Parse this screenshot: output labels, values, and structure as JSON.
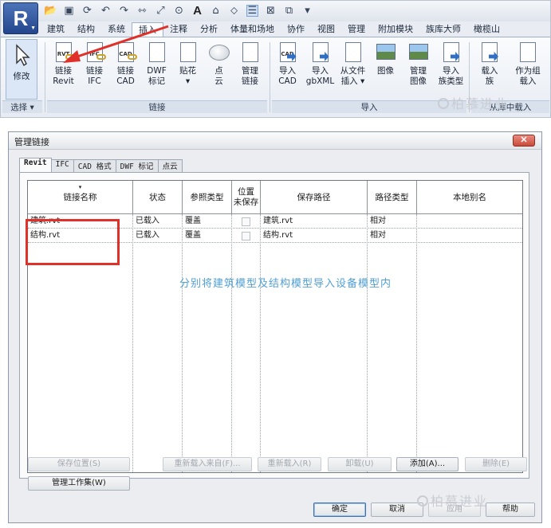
{
  "app": {
    "logo_letter": "R"
  },
  "ribbon": {
    "tabs": [
      "建筑",
      "结构",
      "系统",
      "插入",
      "注释",
      "分析",
      "体量和场地",
      "协作",
      "视图",
      "管理",
      "附加模块",
      "族库大师",
      "橄榄山"
    ],
    "active_tab": "插入",
    "modify": {
      "label": "修改",
      "panel": "选择 ▾"
    },
    "link_panel": {
      "label": "链接",
      "buttons": [
        {
          "line1": "链接",
          "line2": "Revit",
          "badge": "RVT"
        },
        {
          "line1": "链接",
          "line2": "IFC",
          "badge": "IFC"
        },
        {
          "line1": "链接",
          "line2": "CAD",
          "badge": "CAD"
        },
        {
          "line1": "DWF",
          "line2": "标记",
          "badge": ""
        },
        {
          "line1": "贴花",
          "line2": "▾",
          "badge": ""
        },
        {
          "line1": "点",
          "line2": "云",
          "badge": ""
        },
        {
          "line1": "管理",
          "line2": "链接",
          "badge": ""
        }
      ]
    },
    "import_panel": {
      "label": "导入",
      "buttons": [
        {
          "line1": "导入",
          "line2": "CAD",
          "badge": "CAD"
        },
        {
          "line1": "导入",
          "line2": "gbXML",
          "badge": ""
        },
        {
          "line1": "从文件",
          "line2": "插入 ▾",
          "badge": ""
        },
        {
          "line1": "图像",
          "line2": "",
          "badge": ""
        },
        {
          "line1": "管理",
          "line2": "图像",
          "badge": ""
        },
        {
          "line1": "导入",
          "line2": "族类型",
          "badge": ""
        }
      ]
    },
    "family_panel": {
      "label": "从库中载入",
      "buttons": [
        {
          "line1": "载入",
          "line2": "族"
        },
        {
          "line1": "作为组",
          "line2": "载入"
        }
      ]
    }
  },
  "watermark": "柏慕进业",
  "dialog": {
    "title": "管理链接",
    "tabs": [
      "Revit",
      "IFC",
      "CAD 格式",
      "DWF 标记",
      "点云"
    ],
    "active_tab": "Revit",
    "columns": [
      "链接名称",
      "状态",
      "参照类型",
      "位置\n未保存",
      "保存路径",
      "路径类型",
      "本地别名"
    ],
    "rows": [
      {
        "name": "建筑.rvt",
        "status": "已载入",
        "ref_type": "覆盖",
        "unsaved": false,
        "path": "建筑.rvt",
        "path_type": "相对",
        "alias": ""
      },
      {
        "name": "结构.rvt",
        "status": "已载入",
        "ref_type": "覆盖",
        "unsaved": false,
        "path": "结构.rvt",
        "path_type": "相对",
        "alias": ""
      }
    ],
    "annotation": "分别将建筑模型及结构模型导入设备模型内",
    "buttons": {
      "save_location": "保存位置(S)",
      "manage_worksets": "管理工作集(W)",
      "reload_from": "重新载入来自(F)...",
      "reload": "重新载入(R)",
      "unload": "卸载(U)",
      "add": "添加(A)...",
      "remove": "删除(E)",
      "ok": "确定",
      "cancel": "取消",
      "apply": "应用",
      "help": "帮助"
    }
  },
  "colors": {
    "accent": "#2f6fc4",
    "annotation_red": "#e0302a",
    "hint_blue": "#4f9fd6"
  }
}
